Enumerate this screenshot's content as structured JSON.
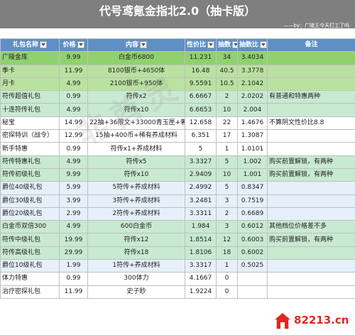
{
  "banner": {
    "title": "代号鸢氪金指北2.0（抽卡版）",
    "credit": "——by：广陵王今天打工了吗"
  },
  "table": {
    "headers": [
      "礼包名称",
      "价格",
      "内容",
      "性价比",
      "抽数",
      "抽数比",
      "备注"
    ],
    "rows": [
      {
        "name": "广陵金库",
        "price": "9.99",
        "content": "白金币6800",
        "value": "11.231",
        "pulls": "34",
        "ratio": "3.4034",
        "note": ""
      },
      {
        "name": "季卡",
        "price": "11.99",
        "content": "8100银币+4650体",
        "value": "16.48",
        "pulls": "40.5",
        "ratio": "3.3778",
        "note": ""
      },
      {
        "name": "月卡",
        "price": "4.99",
        "content": "2100银币+950体",
        "value": "9.5591",
        "pulls": "10.5",
        "ratio": "2.1042",
        "note": ""
      },
      {
        "name": "符传超值礼包",
        "price": "0.99",
        "content": "符传x2",
        "value": "6.6667",
        "pulls": "2",
        "ratio": "2.0202",
        "note": "有普通和特惠两种"
      },
      {
        "name": "十连符传礼包",
        "price": "4.99",
        "content": "符传x10",
        "value": "6.6653",
        "pulls": "10",
        "ratio": "2.004",
        "note": ""
      },
      {
        "name": "秘宝",
        "price": "14.99",
        "content": "22抽+36限文+33000青玉匣+奢算筹",
        "value": "12.658",
        "pulls": "22",
        "ratio": "1.4676",
        "note": "不算阴文性价比8.8"
      },
      {
        "name": "密探特训（战令）",
        "price": "12.99",
        "content": "15抽+400币+稀有养成材料",
        "value": "6.351",
        "pulls": "17",
        "ratio": "1.3087",
        "note": ""
      },
      {
        "name": "新手特惠",
        "price": "0.99",
        "content": "符传x1+养成材料",
        "value": "5",
        "pulls": "1",
        "ratio": "1.0101",
        "note": ""
      },
      {
        "name": "符传特惠礼包",
        "price": "4.99",
        "content": "符传x5",
        "value": "3.3327",
        "pulls": "5",
        "ratio": "1.002",
        "note": "购买前置解锁，有两种"
      },
      {
        "name": "符传初级礼包",
        "price": "9.99",
        "content": "符传x10",
        "value": "2.9409",
        "pulls": "10",
        "ratio": "1.001",
        "note": "购买前置解锁，有两种"
      },
      {
        "name": "爵位40级礼包",
        "price": "5.99",
        "content": "5符传+养成材料",
        "value": "2.4992",
        "pulls": "5",
        "ratio": "0.8347",
        "note": ""
      },
      {
        "name": "爵位30级礼包",
        "price": "3.99",
        "content": "3符传+养成材料",
        "value": "3.2481",
        "pulls": "3",
        "ratio": "0.7519",
        "note": ""
      },
      {
        "name": "爵位20级礼包",
        "price": "2.99",
        "content": "2符传+养成材料",
        "value": "3.3311",
        "pulls": "2",
        "ratio": "0.6689",
        "note": ""
      },
      {
        "name": "白金币双倍300",
        "price": "4.99",
        "content": "600白金币",
        "value": "1.984",
        "pulls": "3",
        "ratio": "0.6012",
        "note": "其他档位价格差不多"
      },
      {
        "name": "符传中级礼包",
        "price": "19.99",
        "content": "符传x12",
        "value": "1.8514",
        "pulls": "12",
        "ratio": "0.6003",
        "note": "购买前置解锁，有两种"
      },
      {
        "name": "符传高级礼包",
        "price": "29.99",
        "content": "符传x18",
        "value": "1.8106",
        "pulls": "18",
        "ratio": "0.6002",
        "note": ""
      },
      {
        "name": "爵位10级礼包",
        "price": "1.99",
        "content": "1符传+养成材料",
        "value": "3.3317",
        "pulls": "1",
        "ratio": "0.5025",
        "note": ""
      },
      {
        "name": "体力特惠",
        "price": "0.99",
        "content": "300体力",
        "value": "4.1667",
        "pulls": "0",
        "ratio": "",
        "note": ""
      },
      {
        "name": "治疗密探礼包",
        "price": "11.99",
        "content": "史子眇",
        "value": "1.9224",
        "pulls": "0",
        "ratio": "",
        "note": ""
      }
    ]
  },
  "watermark": "非酋灵",
  "site_mark": {
    "text": "82213.cn",
    "icon": "house-icon"
  },
  "colors": {
    "banner": "#7f7f7f",
    "header": "#5f8fc7",
    "top_row": "#8fd16f",
    "green_rows": "#b9e2a0",
    "mint_rows": "#c8ead1",
    "light_rows": "#e6f0fa",
    "site_mark": "#e0281e"
  }
}
